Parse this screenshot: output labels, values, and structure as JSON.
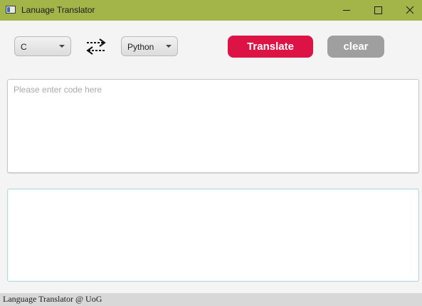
{
  "window": {
    "title": "Lanuage Translator",
    "titlebar_color": "#a3b549",
    "icon": "app-window-icon",
    "controls": [
      "minimize-icon",
      "maximize-icon",
      "close-icon"
    ]
  },
  "toolbar": {
    "source_language": "C",
    "swap_icon": "swap-arrows-icon",
    "target_language": "Python",
    "translate_label": "Translate",
    "translate_color": "#dc1344",
    "clear_label": "clear",
    "clear_color": "#9e9f9e"
  },
  "input": {
    "value": "",
    "placeholder": "Please enter code here"
  },
  "output": {
    "value": ""
  },
  "status_bar": {
    "text": "Language Translator @ UoG"
  }
}
